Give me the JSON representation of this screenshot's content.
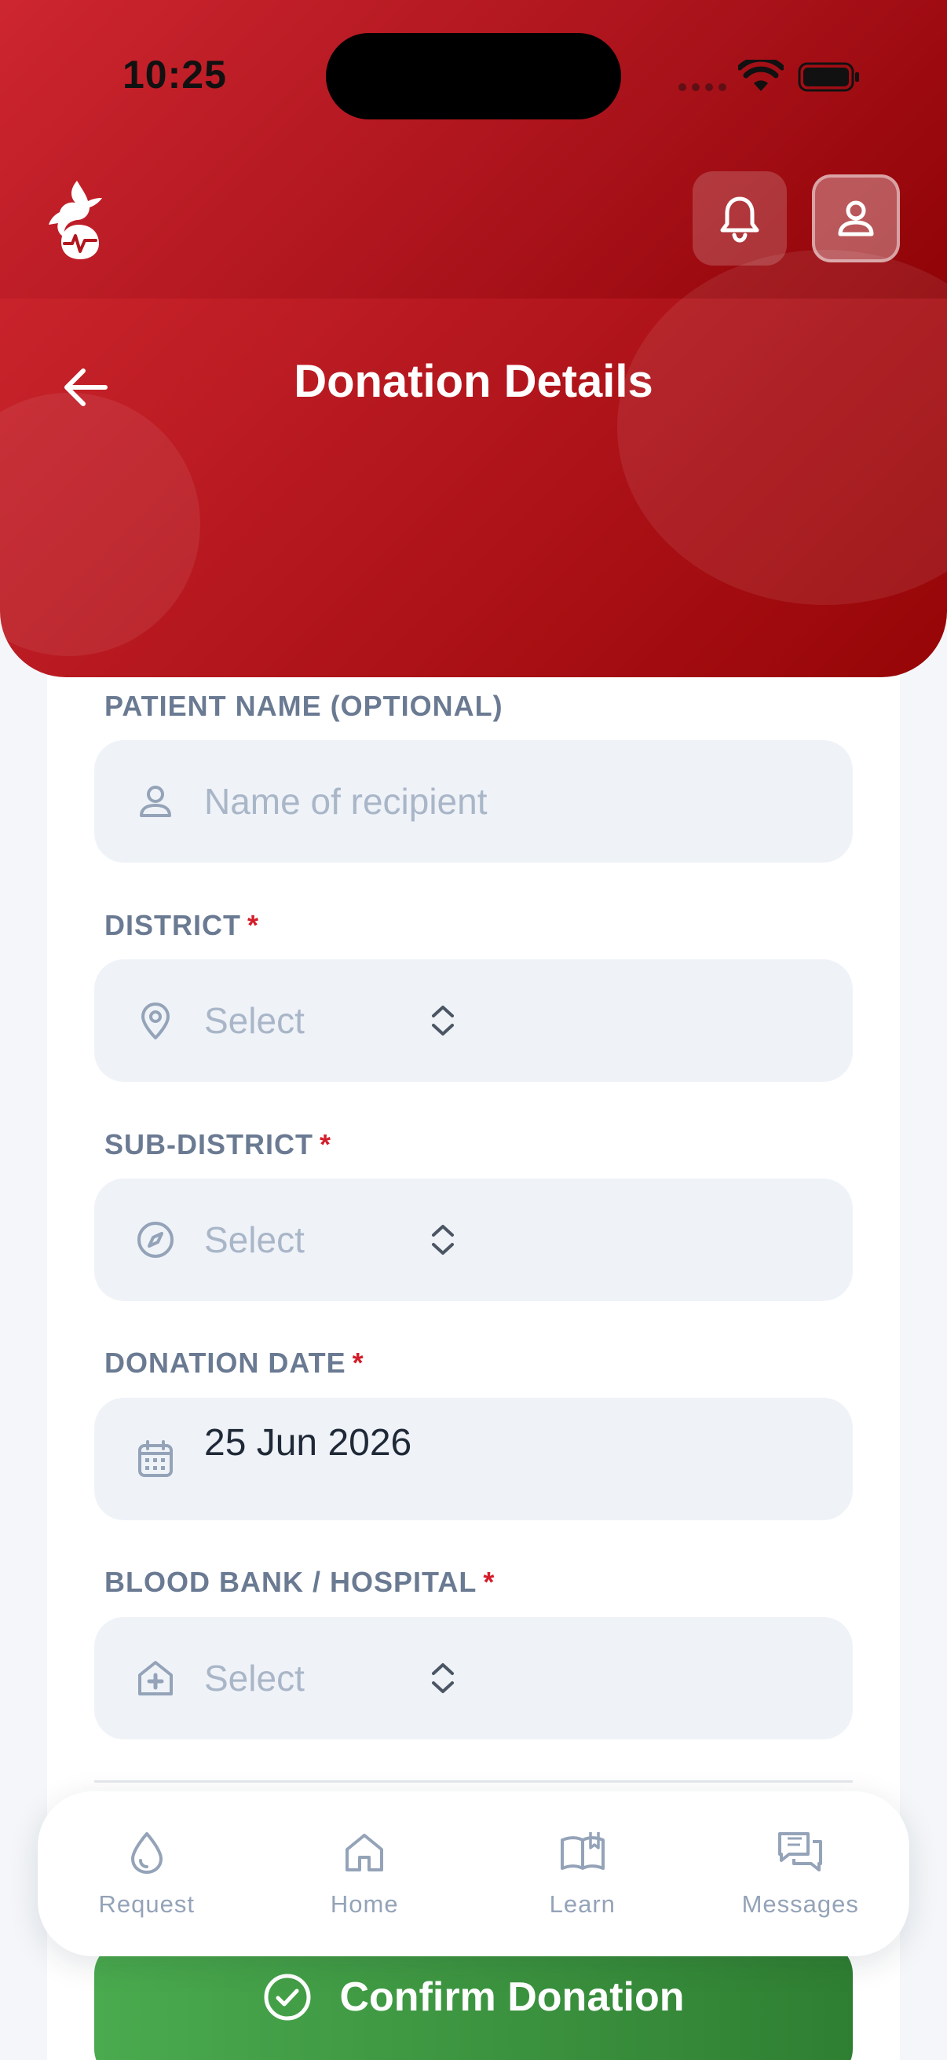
{
  "status_bar": {
    "time": "10:25"
  },
  "header": {
    "title": "Donation Details"
  },
  "form": {
    "patient_name": {
      "label": "PATIENT NAME (OPTIONAL)",
      "placeholder": "Name of recipient"
    },
    "district": {
      "label": "DISTRICT",
      "required_mark": "*",
      "placeholder": "Select"
    },
    "sub_district": {
      "label": "SUB-DISTRICT",
      "required_mark": "*",
      "placeholder": "Select"
    },
    "donation_date": {
      "label": "DONATION DATE",
      "required_mark": "*",
      "value": "25 Jun 2026"
    },
    "blood_bank": {
      "label": "BLOOD BANK / HOSPITAL",
      "required_mark": "*",
      "placeholder": "Select"
    }
  },
  "confirm_button": {
    "label": "Confirm Donation"
  },
  "bottom_nav": {
    "items": [
      {
        "label": "Request",
        "icon": "drop-icon"
      },
      {
        "label": "Home",
        "icon": "home-icon"
      },
      {
        "label": "Learn",
        "icon": "book-icon"
      },
      {
        "label": "Messages",
        "icon": "chat-icon"
      }
    ]
  },
  "colors": {
    "primary_red": "#b3161d",
    "confirm_green": "#3c9640",
    "muted_text": "#6a7a92",
    "placeholder": "#a9b6c8"
  }
}
